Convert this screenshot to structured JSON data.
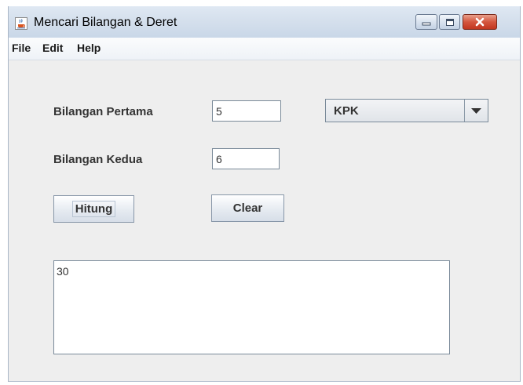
{
  "window": {
    "title": "Mencari Bilangan & Deret",
    "icon": "java-coffee-cup-icon"
  },
  "window_controls": {
    "minimize_icon": "minimize-icon",
    "maximize_icon": "maximize-icon",
    "close_icon": "close-icon",
    "close_color": "#c2361f"
  },
  "menu": {
    "items": [
      "File",
      "Edit",
      "Help"
    ]
  },
  "form": {
    "first_label": "Bilangan Pertama",
    "first_value": "5",
    "second_label": "Bilangan Kedua",
    "second_value": "6",
    "operation": {
      "selected": "KPK",
      "dropdown_icon": "caret-down-icon"
    },
    "hitung_label": "Hitung",
    "clear_label": "Clear"
  },
  "output": {
    "text": "30"
  },
  "colors": {
    "window_bg": "#eeeeee",
    "titlebar": "#d4dfec",
    "border": "#7a8a99"
  }
}
